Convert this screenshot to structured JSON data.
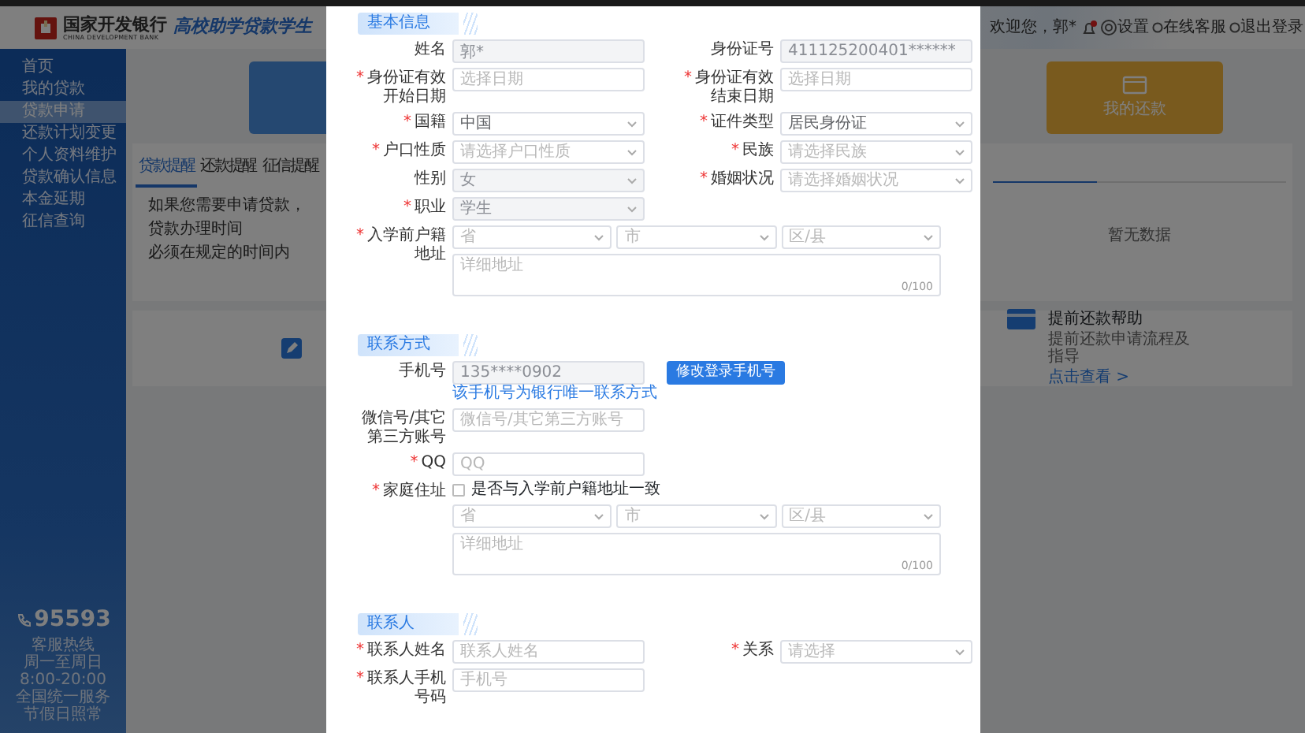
{
  "header": {
    "bank_name": "国家开发银行",
    "bank_name_en": "CHINA DEVELOPMENT BANK",
    "system_title": "高校助学贷款学生",
    "greeting": "欢迎您，郭*",
    "has_notification": true,
    "settings": "设置",
    "online_service": "在线客服",
    "logout": "退出登录"
  },
  "sidebar": {
    "items": [
      {
        "label": "首页",
        "selected": false
      },
      {
        "label": "我的贷款",
        "selected": false
      },
      {
        "label": "贷款申请",
        "selected": true
      },
      {
        "label": "还款计划变更",
        "selected": false
      },
      {
        "label": "个人资料维护",
        "selected": false
      },
      {
        "label": "贷款确认信息",
        "selected": false
      },
      {
        "label": "本金延期",
        "selected": false
      },
      {
        "label": "征信查询",
        "selected": false
      }
    ],
    "hotline": "95593",
    "footer_lines": [
      "客服热线",
      "周一至周日",
      "8:00-20:00",
      "全国统一服务",
      "节假日照常"
    ]
  },
  "dashboard": {
    "shortcut_card": {
      "label": "我的还款"
    },
    "tabs": [
      {
        "label": "贷款提醒",
        "selected": true
      },
      {
        "label": "还款提醒",
        "selected": false
      },
      {
        "label": "征信提醒",
        "selected": false
      }
    ],
    "notice_lines": [
      "如果您需要申请贷款，",
      "贷款办理时间",
      "必须在规定的时间内"
    ],
    "empty_text": "暂无数据",
    "help": {
      "title": "提前还款帮助",
      "description": "提前还款申请流程及指导",
      "link": "点击查看 >"
    }
  },
  "dialog": {
    "required_mark": "*",
    "sections": [
      {
        "title": "基本信息",
        "rows": [
          [
            {
              "kind": "input",
              "label": "姓名",
              "required": false,
              "value": "郭*",
              "disabled": true
            },
            {
              "kind": "input",
              "label": "身份证号",
              "required": false,
              "value": "411125200401******",
              "disabled": true
            }
          ],
          [
            {
              "kind": "input",
              "label": "身份证有效开始日期",
              "required": true,
              "placeholder": "选择日期"
            },
            {
              "kind": "input",
              "label": "身份证有效结束日期",
              "required": true,
              "placeholder": "选择日期"
            }
          ],
          [
            {
              "kind": "select",
              "label": "国籍",
              "required": true,
              "value": "中国"
            },
            {
              "kind": "select",
              "label": "证件类型",
              "required": true,
              "value": "居民身份证"
            }
          ],
          [
            {
              "kind": "select",
              "label": "户口性质",
              "required": true,
              "placeholder": "请选择户口性质"
            },
            {
              "kind": "select",
              "label": "民族",
              "required": true,
              "placeholder": "请选择民族"
            }
          ],
          [
            {
              "kind": "select",
              "label": "性别",
              "required": false,
              "value": "女",
              "disabled": true
            },
            {
              "kind": "select",
              "label": "婚姻状况",
              "required": true,
              "placeholder": "请选择婚姻状况"
            }
          ],
          [
            {
              "kind": "select",
              "label": "职业",
              "required": true,
              "value": "学生",
              "disabled": true
            }
          ],
          [
            {
              "kind": "address",
              "label": "入学前户籍地址",
              "required": true,
              "regions": [
                "省",
                "市",
                "区/县"
              ],
              "placeholder": "详细地址",
              "counter": "0/100"
            }
          ]
        ]
      },
      {
        "title": "联系方式",
        "rows": [
          [
            {
              "kind": "phone",
              "label": "手机号",
              "required": false,
              "value": "135****0902",
              "disabled": true,
              "button": "修改登录手机号",
              "hint": "该手机号为银行唯一联系方式"
            }
          ],
          [
            {
              "kind": "input",
              "label": "微信号/其它第三方账号",
              "required": false,
              "placeholder": "微信号/其它第三方账号"
            }
          ],
          [
            {
              "kind": "input",
              "label": "QQ",
              "required": true,
              "placeholder": "QQ"
            }
          ],
          [
            {
              "kind": "address",
              "label": "家庭住址",
              "required": true,
              "checkbox": {
                "label": "是否与入学前户籍地址一致",
                "checked": false
              },
              "regions": [
                "省",
                "市",
                "区/县"
              ],
              "placeholder": "详细地址",
              "counter": "0/100"
            }
          ]
        ]
      },
      {
        "title": "联系人",
        "rows": [
          [
            {
              "kind": "input",
              "label": "联系人姓名",
              "required": true,
              "placeholder": "联系人姓名"
            },
            {
              "kind": "select",
              "label": "关系",
              "required": true,
              "placeholder": "请选择"
            }
          ],
          [
            {
              "kind": "input",
              "label": "联系人手机号码",
              "required": true,
              "placeholder": "手机号"
            }
          ]
        ]
      }
    ]
  }
}
